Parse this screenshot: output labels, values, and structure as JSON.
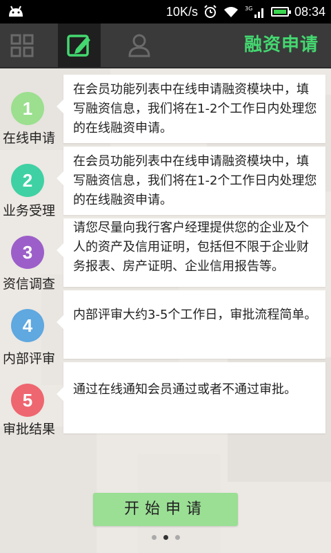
{
  "status_bar": {
    "speed": "10K/s",
    "network": "3G",
    "time": "08:34",
    "icons": [
      "android-icon",
      "alarm-icon",
      "wifi-icon",
      "signal-icon",
      "battery-icon"
    ]
  },
  "header": {
    "title": "融资申请",
    "title_color": "#44d870",
    "tabs": [
      {
        "icon": "grid-icon",
        "active": false
      },
      {
        "icon": "edit-icon",
        "active": true
      },
      {
        "icon": "user-icon",
        "active": false
      }
    ]
  },
  "steps": [
    {
      "number": "1",
      "label": "在线申请",
      "color": "#9bdf8f",
      "text": "在会员功能列表中在线申请融资模块中，填写融资信息，我们将在1-2个工作日内处理您的在线融资申请。"
    },
    {
      "number": "2",
      "label": "业务受理",
      "color": "#3fd1a3",
      "text": "在会员功能列表中在线申请融资模块中，填写融资信息，我们将在1-2个工作日内处理您的在线融资申请。"
    },
    {
      "number": "3",
      "label": "资信调查",
      "color": "#9c5fc9",
      "text": "请您尽量向我行客户经理提供您的企业及个人的资产及信用证明，包括但不限于企业财务报表、房产证明、企业信用报告等。"
    },
    {
      "number": "4",
      "label": "内部评审",
      "color": "#5fa8e0",
      "text": "内部评审大约3-5个工作日，审批流程简单。"
    },
    {
      "number": "5",
      "label": "审批结果",
      "color": "#ee6670",
      "text": "通过在线通知会员通过或者不通过审批。"
    }
  ],
  "start_button": {
    "label": "开始申请"
  },
  "pager": {
    "count": 3,
    "active_index": 1
  }
}
